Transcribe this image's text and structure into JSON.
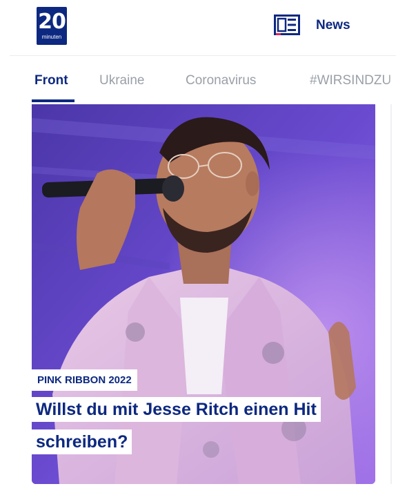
{
  "header": {
    "logo": {
      "number": "20",
      "subtext": "minuten"
    },
    "news_label": "News",
    "colors": {
      "brand": "#0d2880"
    }
  },
  "tabs": [
    {
      "label": "Front",
      "active": true
    },
    {
      "label": "Ukraine",
      "active": false
    },
    {
      "label": "Coronavirus",
      "active": false
    },
    {
      "label": "#WIRSINDZU",
      "active": false
    }
  ],
  "article": {
    "kicker": "PINK RIBBON 2022",
    "headline": "Willst du mit Jesse Ritch einen Hit schreiben?",
    "image_icon": "singer-photo"
  }
}
